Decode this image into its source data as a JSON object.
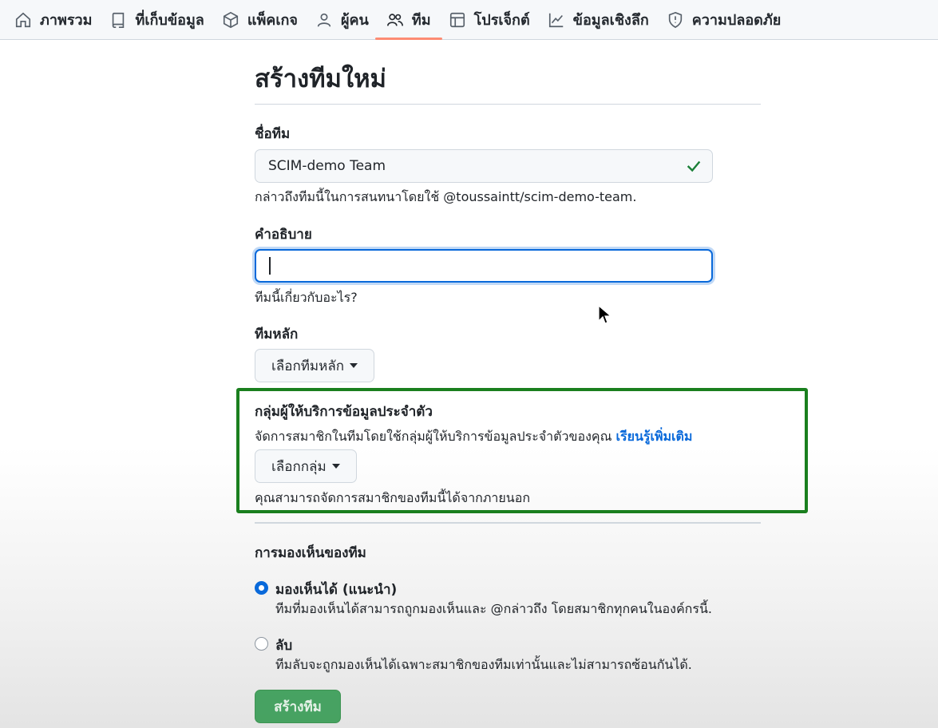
{
  "nav": {
    "items": [
      {
        "label": "ภาพรวม",
        "icon": "home-icon",
        "active": false
      },
      {
        "label": "ที่เก็บข้อมูล",
        "icon": "repo-icon",
        "active": false
      },
      {
        "label": "แพ็คเกจ",
        "icon": "package-icon",
        "active": false
      },
      {
        "label": "ผู้คน",
        "icon": "person-icon",
        "active": false
      },
      {
        "label": "ทีม",
        "icon": "people-icon",
        "active": true
      },
      {
        "label": "โปรเจ็กต์",
        "icon": "table-icon",
        "active": false
      },
      {
        "label": "ข้อมูลเชิงลึก",
        "icon": "graph-icon",
        "active": false
      },
      {
        "label": "ความปลอดภัย",
        "icon": "shield-icon",
        "active": false
      }
    ]
  },
  "page": {
    "title": "สร้างทีมใหม่"
  },
  "team_name": {
    "label": "ชื่อทีม",
    "value": "SCIM-demo Team",
    "hint": "กล่าวถึงทีมนี้ในการสนทนาโดยใช้ @toussaintt/scim-demo-team."
  },
  "description": {
    "label": "คำอธิบาย",
    "value": "",
    "hint": "ทีมนี้เกี่ยวกับอะไร?"
  },
  "parent_team": {
    "label": "ทีมหลัก",
    "button": "เลือกทีมหลัก"
  },
  "idp_group": {
    "label": "กลุ่มผู้ให้บริการข้อมูลประจำตัว",
    "desc": "จัดการสมาชิกในทีมโดยใช้กลุ่มผู้ให้บริการข้อมูลประจำตัวของคุณ",
    "learn_more": "เรียนรู้เพิ่มเติม",
    "button": "เลือกกลุ่ม",
    "hint": "คุณสามารถจัดการสมาชิกของทีมนี้ได้จากภายนอก"
  },
  "visibility": {
    "label": "การมองเห็นของทีม",
    "options": [
      {
        "label": "มองเห็นได้ (แนะนำ)",
        "desc": "ทีมที่มองเห็นได้สามารถถูกมองเห็นและ @กล่าวถึง โดยสมาชิกทุกคนในองค์กรนี้.",
        "checked": true
      },
      {
        "label": "ลับ",
        "desc": "ทีมลับจะถูกมองเห็นได้เฉพาะสมาชิกของทีมเท่านั้นและไม่สามารถซ้อนกันได้.",
        "checked": false
      }
    ]
  },
  "submit": {
    "label": "สร้างทีม"
  },
  "colors": {
    "accent": "#0969da",
    "highlight_box": "#1a7f1e",
    "primary_button": "#2c974b",
    "active_tab_underline": "#fd8c73"
  }
}
